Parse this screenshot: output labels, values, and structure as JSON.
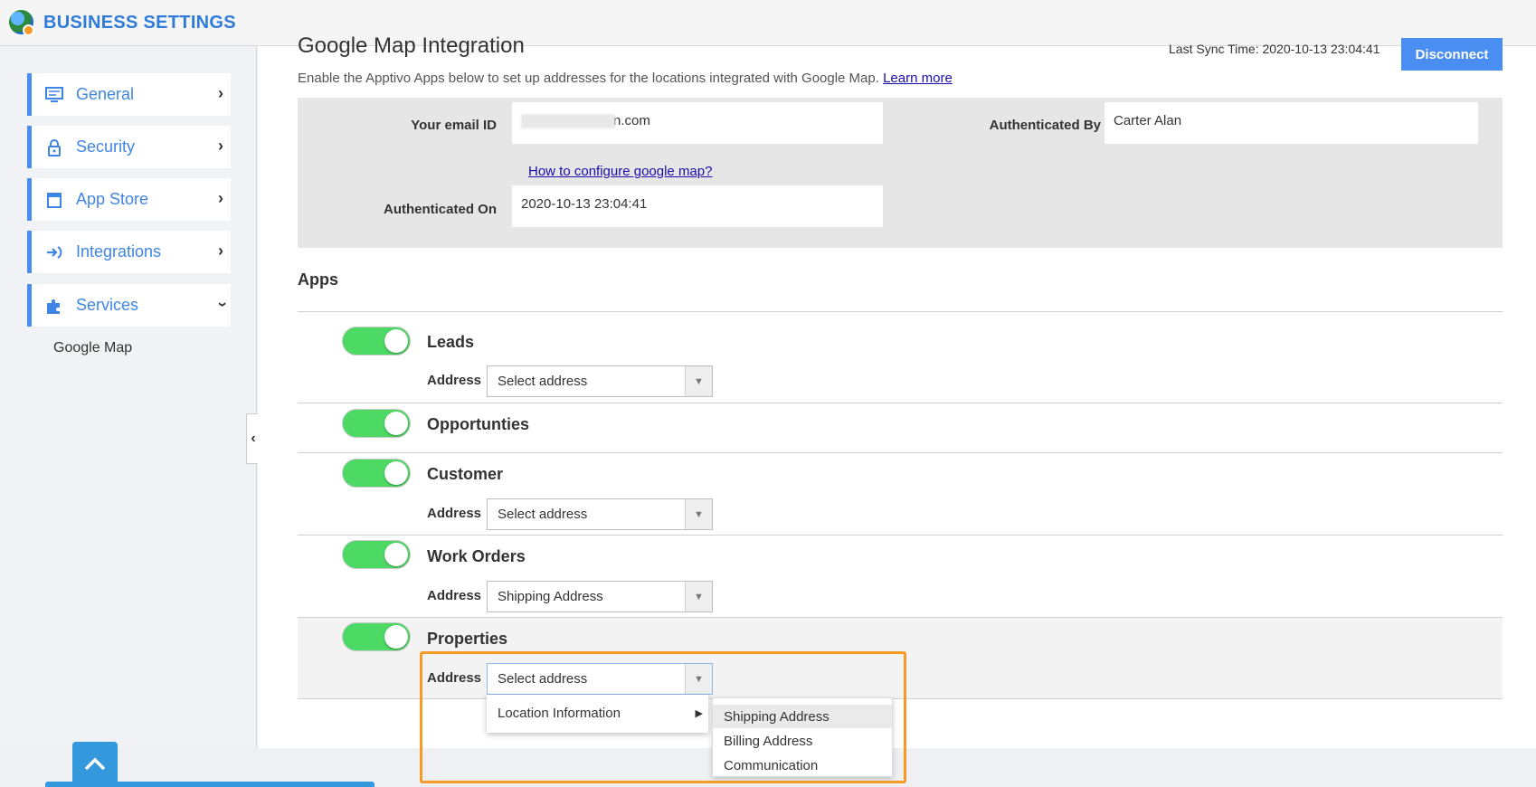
{
  "header": {
    "title": "BUSINESS SETTINGS"
  },
  "sidebar": {
    "items": [
      {
        "label": "General",
        "icon": "monitor-icon"
      },
      {
        "label": "Security",
        "icon": "lock-icon"
      },
      {
        "label": "App Store",
        "icon": "store-icon"
      },
      {
        "label": "Integrations",
        "icon": "integrations-icon"
      },
      {
        "label": "Services",
        "icon": "puzzle-icon"
      }
    ],
    "sub_item": "Google Map"
  },
  "main": {
    "heading": "Google Map Integration",
    "last_sync": "Last Sync Time: 2020-10-13 23:04:41",
    "disconnect_label": "Disconnect",
    "description": "Enable the Apptivo Apps below to set up addresses for the locations integrated with Google Map.",
    "learn_more": "Learn more",
    "auth": {
      "email_label": "Your email ID",
      "email_value_suffix": "n.com",
      "how_to_link": "How to configure google map?",
      "auth_on_label": "Authenticated On",
      "auth_on_value": "2020-10-13 23:04:41",
      "auth_by_label": "Authenticated By",
      "auth_by_value": "Carter Alan"
    },
    "apps_title": "Apps",
    "address_label": "Address",
    "apps": [
      {
        "name": "Leads",
        "enabled": true,
        "address": "Select address"
      },
      {
        "name": "Opportunties",
        "enabled": true
      },
      {
        "name": "Customer",
        "enabled": true,
        "address": "Select address"
      },
      {
        "name": "Work Orders",
        "enabled": true,
        "address": "Shipping Address"
      },
      {
        "name": "Properties",
        "enabled": true,
        "address": "Select address"
      }
    ],
    "dropdown": {
      "group": "Location Information",
      "options": [
        "Shipping Address",
        "Billing Address",
        "Communication"
      ],
      "highlighted": "Shipping Address"
    }
  },
  "colors": {
    "accent": "#4b8ef1",
    "toggle_on": "#4cd964",
    "highlight_border": "#f59a23",
    "link": "#1a0dab"
  }
}
